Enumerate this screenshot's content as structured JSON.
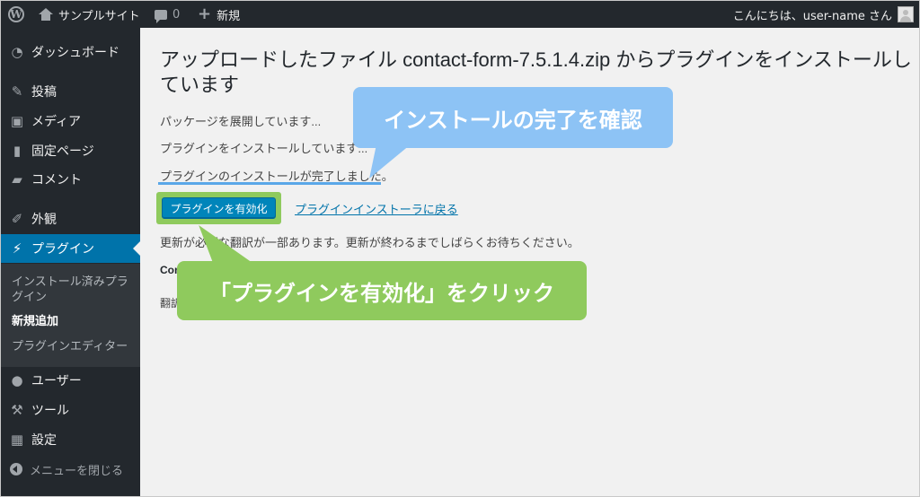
{
  "adminbar": {
    "site_name": "サンプルサイト",
    "comment_count": "0",
    "new_label": "新規",
    "greeting": "こんにちは、user-name さん"
  },
  "sidebar": {
    "items": [
      {
        "label": "ダッシュボード",
        "icon": "dashboard-icon"
      },
      {
        "label": "投稿",
        "icon": "pin-icon"
      },
      {
        "label": "メディア",
        "icon": "media-icon"
      },
      {
        "label": "固定ページ",
        "icon": "page-icon"
      },
      {
        "label": "コメント",
        "icon": "comment-icon"
      },
      {
        "label": "外観",
        "icon": "brush-icon"
      },
      {
        "label": "プラグイン",
        "icon": "plugin-icon"
      },
      {
        "label": "ユーザー",
        "icon": "user-icon"
      },
      {
        "label": "ツール",
        "icon": "wrench-icon"
      },
      {
        "label": "設定",
        "icon": "settings-icon"
      }
    ],
    "submenu": [
      "インストール済みプラグイン",
      "新規追加",
      "プラグインエディター"
    ],
    "collapse_label": "メニューを閉じる"
  },
  "main": {
    "title": "アップロードしたファイル contact-form-7.5.1.4.zip からプラグインをインストールしています",
    "messages": [
      "パッケージを展開しています...",
      "プラグインをインストールしています...",
      "プラグインのインストールが完了しました。"
    ],
    "activate_button": "プラグインを有効化",
    "return_link": "プラグインインストーラに戻る",
    "update_notice": "更新が必要な翻訳が一部あります。更新が終わるまでしばらくお待ちください。",
    "bold_partial": "Con",
    "small_partial": "翻訳"
  },
  "callouts": {
    "confirm": "インストールの完了を確認",
    "click": "「プラグインを有効化」をクリック"
  }
}
